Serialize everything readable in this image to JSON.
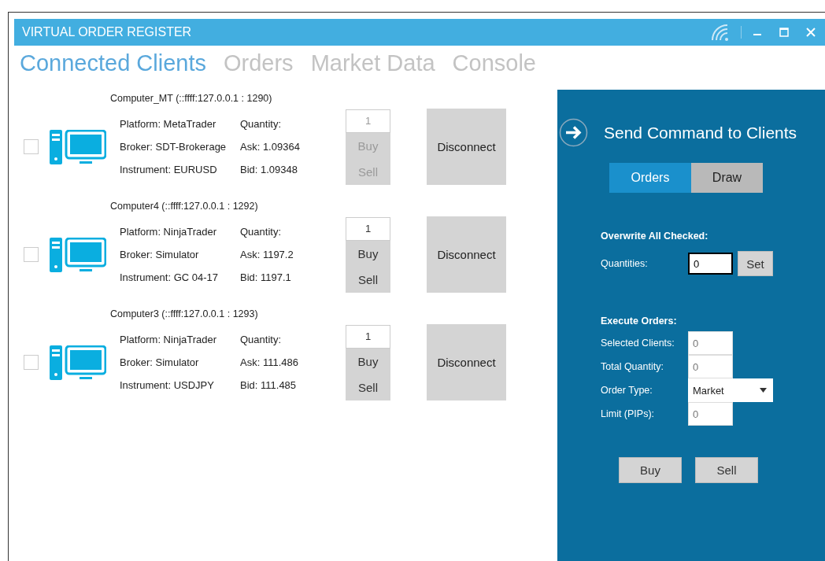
{
  "window": {
    "title": "VIRTUAL ORDER REGISTER"
  },
  "tabs": [
    {
      "label": "Connected Clients",
      "selected": true
    },
    {
      "label": "Orders",
      "selected": false
    },
    {
      "label": "Market Data",
      "selected": false
    },
    {
      "label": "Console",
      "selected": false
    }
  ],
  "clients": [
    {
      "header": "Computer_MT (::ffff:127.0.0.1 : 1290)",
      "checked": false,
      "disabled": true,
      "platform": "Platform: MetaTrader",
      "broker": "Broker: SDT-Brokerage",
      "instrument": "Instrument: EURUSD",
      "quantity_label": "Quantity:",
      "ask": "Ask: 1.09364",
      "bid": "Bid: 1.09348",
      "quantity": "1",
      "buy": "Buy",
      "sell": "Sell",
      "disconnect": "Disconnect"
    },
    {
      "header": "Computer4 (::ffff:127.0.0.1 : 1292)",
      "checked": false,
      "disabled": false,
      "platform": "Platform: NinjaTrader",
      "broker": "Broker: Simulator",
      "instrument": "Instrument: GC 04-17",
      "quantity_label": "Quantity:",
      "ask": "Ask: 1197.2",
      "bid": "Bid: 1197.1",
      "quantity": "1",
      "buy": "Buy",
      "sell": "Sell",
      "disconnect": "Disconnect"
    },
    {
      "header": "Computer3 (::ffff:127.0.0.1 : 1293)",
      "checked": false,
      "disabled": false,
      "platform": "Platform: NinjaTrader",
      "broker": "Broker: Simulator",
      "instrument": "Instrument: USDJPY",
      "quantity_label": "Quantity:",
      "ask": "Ask: 111.486",
      "bid": "Bid: 111.485",
      "quantity": "1",
      "buy": "Buy",
      "sell": "Sell",
      "disconnect": "Disconnect"
    }
  ],
  "command_panel": {
    "title": "Send Command to Clients",
    "tabs": [
      {
        "label": "Orders",
        "selected": true
      },
      {
        "label": "Draw",
        "selected": false
      }
    ],
    "overwrite": {
      "heading": "Overwrite All Checked:",
      "label": "Quantities:",
      "value": "0",
      "button": "Set"
    },
    "execute": {
      "heading": "Execute Orders:",
      "fields": [
        {
          "kind": "text",
          "label": "Selected Clients:",
          "value": "0"
        },
        {
          "kind": "text",
          "label": "Total Quantity:",
          "value": "0"
        },
        {
          "kind": "dropdown",
          "label": "Order Type:",
          "value": "Market"
        },
        {
          "kind": "text",
          "label": "Limit (PIPs):",
          "value": "0"
        }
      ]
    },
    "buttons": [
      "Buy",
      "Sell"
    ]
  }
}
